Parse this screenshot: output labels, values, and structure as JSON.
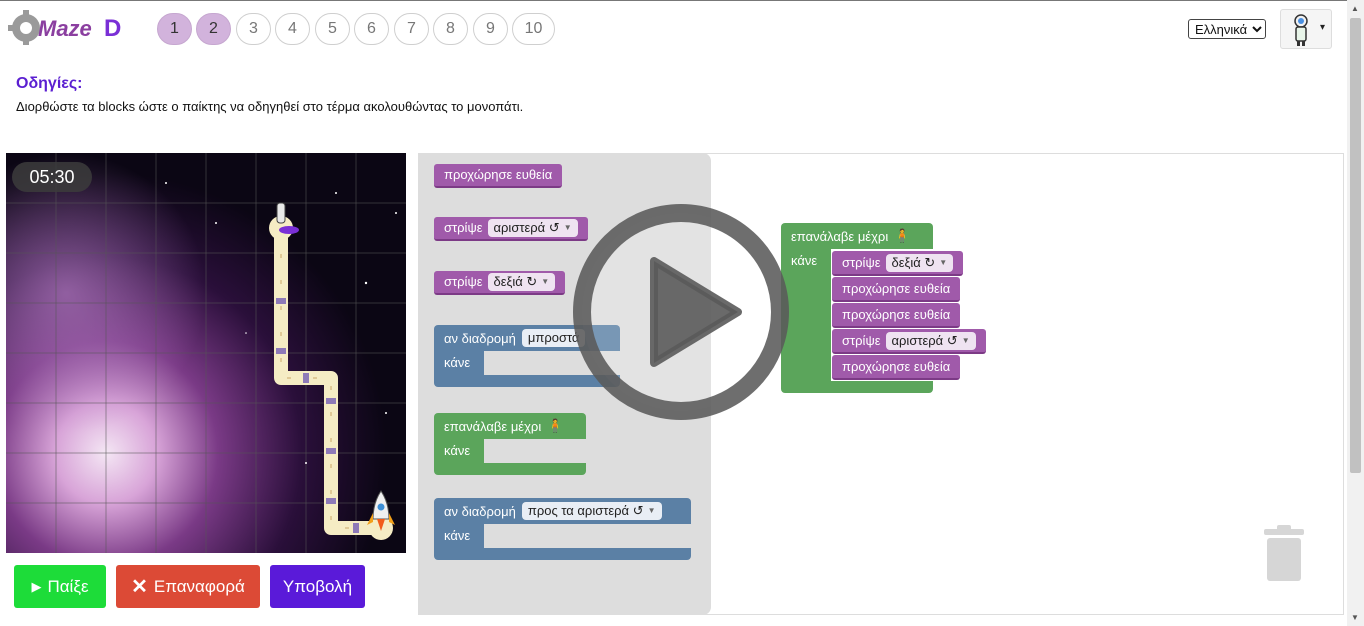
{
  "header": {
    "logo_text": "aMazeD",
    "levels": [
      "1",
      "2",
      "3",
      "4",
      "5",
      "6",
      "7",
      "8",
      "9",
      "10"
    ],
    "completed_levels": [
      "1",
      "2"
    ],
    "language_select": {
      "selected": "Ελληνικά"
    },
    "user_menu_caret": "▾"
  },
  "instructions": {
    "title": "Οδηγίες:",
    "text": "Διορθώστε τα blocks ώστε ο παίκτης να οδηγηθεί στο τέρμα ακολουθώντας το μονοπάτι."
  },
  "game": {
    "timer": "05:30"
  },
  "controls": {
    "play_label": "Παίξε",
    "reset_label": "Επαναφορά",
    "submit_label": "Υποβολή"
  },
  "toolbox": {
    "forward_block": "προχώρησε ευθεία",
    "turn_left": {
      "label": "στρίψε",
      "value": "αριστερά ↺"
    },
    "turn_right": {
      "label": "στρίψε",
      "value": "δεξιά ↻"
    },
    "if_path_ahead": {
      "label": "αν διαδρομή",
      "value": "μπροστά",
      "do_label": "κάνε"
    },
    "repeat_until": {
      "label": "επανάλαβε μέχρι",
      "do_label": "κάνε"
    },
    "if_path_left": {
      "label": "αν διαδρομή",
      "value": "προς τα αριστερά ↺",
      "do_label": "κάνε"
    }
  },
  "program": {
    "repeat_label": "επανάλαβε μέχρι",
    "do_label": "κάνε",
    "steps": [
      {
        "label": "στρίψε",
        "value": "δεξιά ↻"
      },
      {
        "label": "προχώρησε ευθεία"
      },
      {
        "label": "προχώρησε ευθεία"
      },
      {
        "label": "στρίψε",
        "value": "αριστερά ↺"
      },
      {
        "label": "προχώρησε ευθεία"
      }
    ]
  },
  "colors": {
    "motion_block": "#a05aaa",
    "logic_block": "#5b80a5",
    "loop_block": "#5ba55b",
    "play_button": "#1ddc39",
    "reset_button": "#dc4a36",
    "submit_button": "#5a1ad9",
    "completed_level": "#d2b3dc"
  }
}
